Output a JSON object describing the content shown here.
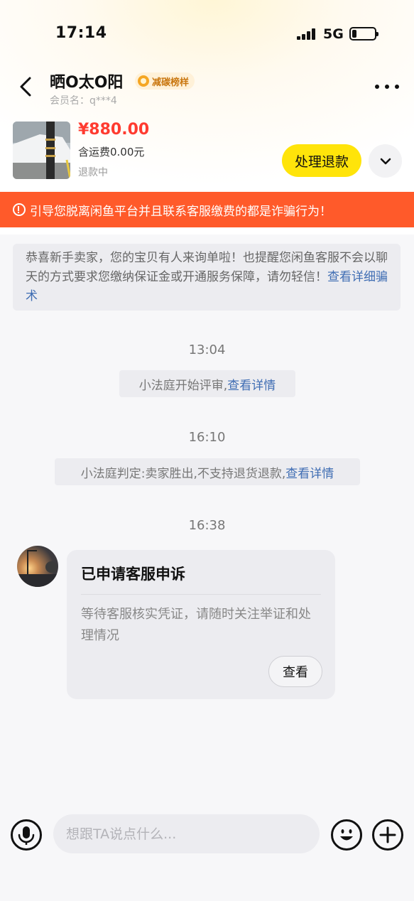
{
  "status_bar": {
    "time": "17:14",
    "network": "5G"
  },
  "header": {
    "shop_name": "晒O太O阳",
    "badge": "减碳榜样",
    "member": "会员名：q***4"
  },
  "product": {
    "price": "¥880.00",
    "shipping": "含运费0.00元",
    "status": "退款中",
    "action_label": "处理退款"
  },
  "warning": "引导您脱离闲鱼平台并且联系客服缴费的都是诈骗行为！",
  "notice": {
    "text": "恭喜新手卖家，您的宝贝有人来询单啦！也提醒您闲鱼客服不会以聊天的方式要求您缴纳保证金或开通服务保障，请勿轻信！",
    "link": "查看详细骗术"
  },
  "messages": [
    {
      "time": "13:04",
      "text": "小法庭开始评审,",
      "link": "查看详情"
    },
    {
      "time": "16:10",
      "text": "小法庭判定:卖家胜出,不支持退货退款,",
      "link": "查看详情"
    }
  ],
  "card": {
    "time": "16:38",
    "title": "已申请客服申诉",
    "body": "等待客服核实凭证，请随时关注举证和处理情况",
    "button": "查看"
  },
  "input": {
    "placeholder": "想跟TA说点什么..."
  },
  "colors": {
    "accent_yellow": "#ffe40a",
    "warning": "#ff5a2a",
    "price": "#ff3b30",
    "link": "#3f6db3"
  },
  "icons": [
    "back-icon",
    "more-icon",
    "badge-icon",
    "chevron-down-icon",
    "warning-icon",
    "voice-icon",
    "emoji-icon",
    "plus-icon"
  ]
}
